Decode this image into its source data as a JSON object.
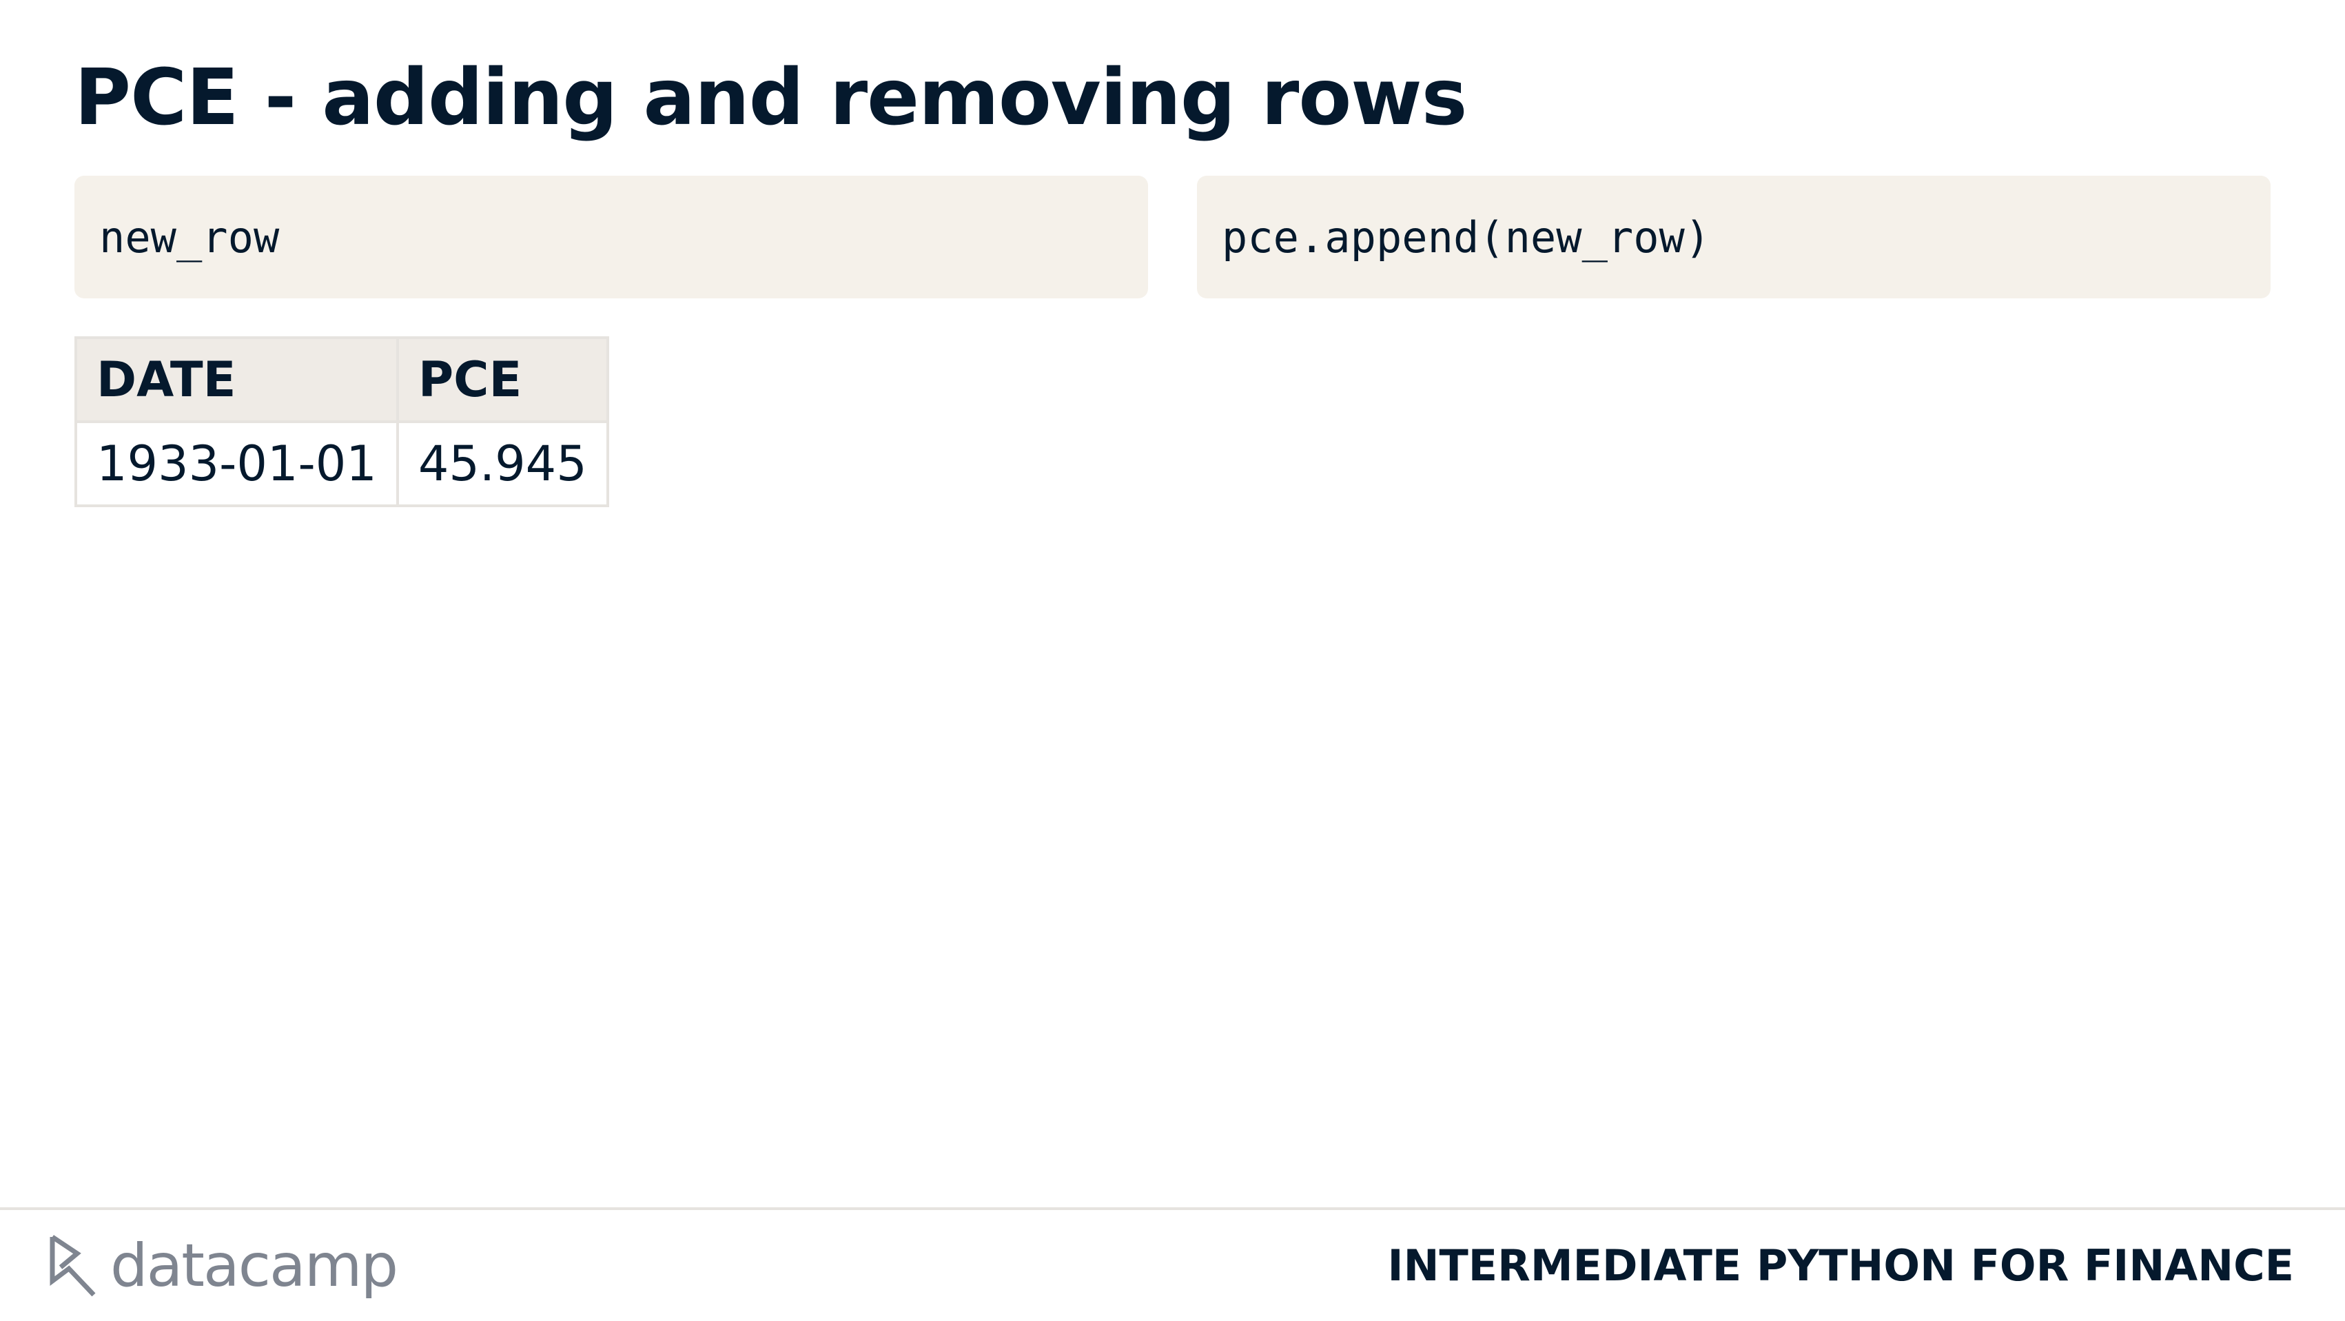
{
  "slide": {
    "title": "PCE - adding and removing rows"
  },
  "code_blocks": {
    "left": "new_row",
    "right": "pce.append(new_row)"
  },
  "table": {
    "headers": [
      "DATE",
      "PCE"
    ],
    "rows": [
      [
        "1933-01-01",
        "45.945"
      ]
    ]
  },
  "footer": {
    "logo_text": "datacamp",
    "logo_icon": "datacamp-logo-icon",
    "course_name": "INTERMEDIATE PYTHON FOR FINANCE"
  },
  "colors": {
    "text": "#05192d",
    "code_background": "#f5f1ea",
    "table_header_background": "#efebe6",
    "border": "#e6e3df",
    "logo": "#7f8590"
  }
}
